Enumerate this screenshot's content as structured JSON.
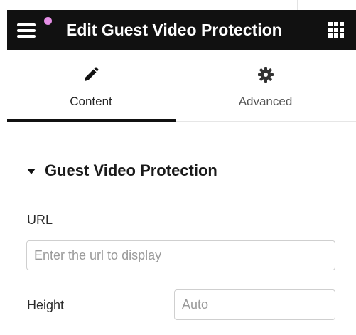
{
  "header": {
    "title": "Edit Guest Video Protection",
    "menu_icon": "hamburger-menu-icon",
    "apps_icon": "grid-apps-icon",
    "notification_color": "#e58ee6",
    "background_color": "#111111"
  },
  "tabs": [
    {
      "label": "Content",
      "icon": "pencil-icon",
      "active": true
    },
    {
      "label": "Advanced",
      "icon": "gear-icon",
      "active": false
    }
  ],
  "section": {
    "title": "Guest Video Protection",
    "expanded": true
  },
  "fields": {
    "url": {
      "label": "URL",
      "placeholder": "Enter the url to display",
      "value": ""
    },
    "height": {
      "label": "Height",
      "placeholder": "Auto",
      "value": ""
    }
  }
}
